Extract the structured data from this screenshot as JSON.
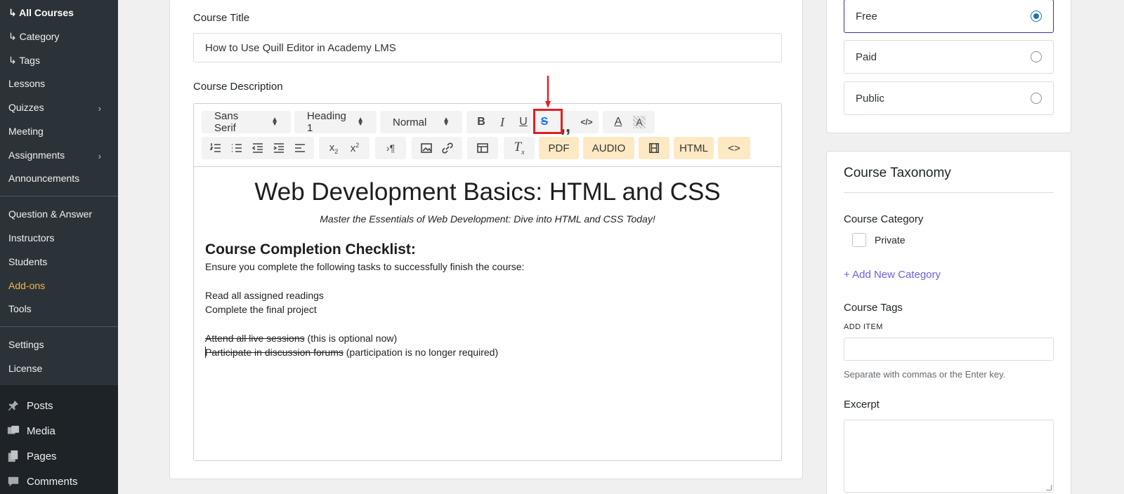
{
  "sidebar": {
    "items": [
      {
        "label": "↳ All Courses"
      },
      {
        "label": "↳ Category"
      },
      {
        "label": "↳ Tags"
      },
      {
        "label": "Lessons"
      },
      {
        "label": "Quizzes"
      },
      {
        "label": "Meeting"
      },
      {
        "label": "Assignments"
      },
      {
        "label": "Announcements"
      },
      {
        "label": "Question & Answer"
      },
      {
        "label": "Instructors"
      },
      {
        "label": "Students"
      },
      {
        "label": "Add-ons"
      },
      {
        "label": "Tools"
      },
      {
        "label": "Settings"
      },
      {
        "label": "License"
      }
    ],
    "main_nav": [
      {
        "label": "Posts",
        "icon": "pin-icon"
      },
      {
        "label": "Media",
        "icon": "media-icon"
      },
      {
        "label": "Pages",
        "icon": "pages-icon"
      },
      {
        "label": "Comments",
        "icon": "comment-icon"
      }
    ],
    "accent_color": "#f0b849"
  },
  "course": {
    "title_label": "Course Title",
    "title_value": "How to Use Quill Editor in Academy LMS",
    "description_label": "Course Description"
  },
  "toolbar": {
    "font": "Sans Serif",
    "header": "Heading 1",
    "size": "Normal",
    "pdf": "PDF",
    "audio": "AUDIO",
    "html": "HTML",
    "code_view": "<>"
  },
  "editor_content": {
    "heading": "Web Development Basics: HTML and CSS",
    "subtitle": "Master the Essentials of Web Development: Dive into HTML and CSS Today!",
    "checklist_heading": "Course Completion Checklist:",
    "intro": "Ensure you complete the following tasks to successfully finish the course:",
    "task1": "Read all assigned readings",
    "task2": "Complete the final project",
    "task3_struck": "Attend all live sessions",
    "task3_note": " (this is optional now)",
    "task4_struck": "Participate in discussion forums",
    "task4_note": " (participation is no longer required)"
  },
  "pricing": {
    "options": [
      {
        "label": "Free",
        "selected": true
      },
      {
        "label": "Paid",
        "selected": false
      },
      {
        "label": "Public",
        "selected": false
      }
    ]
  },
  "taxonomy": {
    "title": "Course Taxonomy",
    "category_label": "Course Category",
    "category_option": "Private",
    "add_category": "+ Add New Category",
    "tags_label": "Course Tags",
    "add_item": "ADD ITEM",
    "tags_hint": "Separate with commas or the Enter key.",
    "excerpt_label": "Excerpt"
  },
  "colors": {
    "highlight": "#e02020",
    "link": "#6b61e0",
    "radio_selected": "#2271b1"
  }
}
